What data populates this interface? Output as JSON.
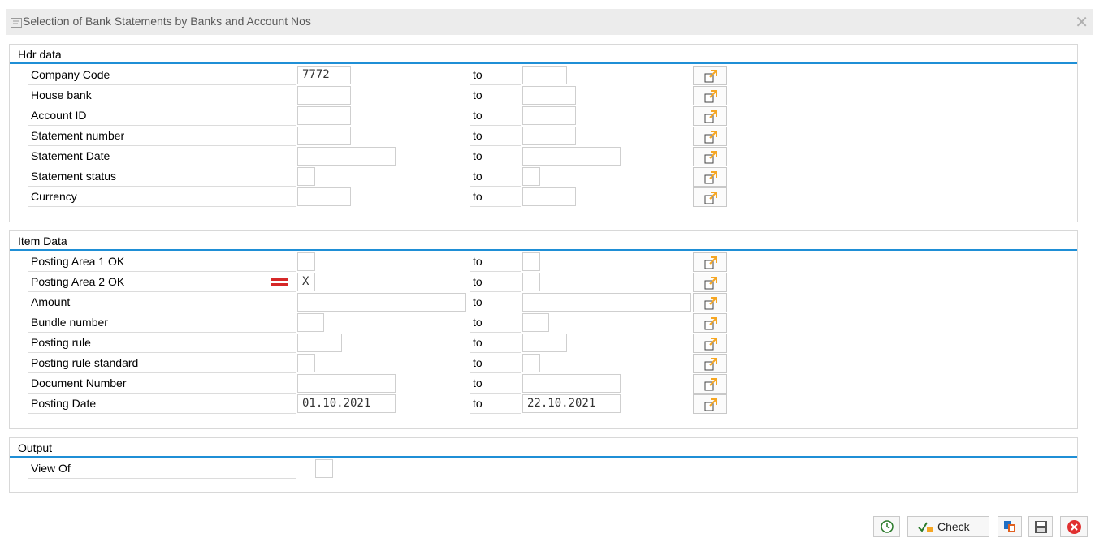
{
  "window": {
    "title": "Selection of Bank Statements by Banks and Account Nos"
  },
  "hdr": {
    "title": "Hdr data",
    "rows": [
      {
        "label": "Company Code",
        "from": "7772",
        "to_label": "to",
        "to": ""
      },
      {
        "label": "House bank",
        "from": "",
        "to_label": "to",
        "to": ""
      },
      {
        "label": "Account ID",
        "from": "",
        "to_label": "to",
        "to": ""
      },
      {
        "label": "Statement number",
        "from": "",
        "to_label": "to",
        "to": ""
      },
      {
        "label": "Statement Date",
        "from": "",
        "to_label": "to",
        "to": ""
      },
      {
        "label": "Statement status",
        "from": "",
        "to_label": "to",
        "to": ""
      },
      {
        "label": "Currency",
        "from": "",
        "to_label": "to",
        "to": ""
      }
    ]
  },
  "item": {
    "title": "Item Data",
    "rows": [
      {
        "label": "Posting Area 1 OK",
        "from": "",
        "to_label": "to",
        "to": ""
      },
      {
        "label": "Posting Area 2 OK",
        "from": "X",
        "to_label": "to",
        "to": ""
      },
      {
        "label": "Amount",
        "from": "",
        "to_label": "to",
        "to": ""
      },
      {
        "label": "Bundle number",
        "from": "",
        "to_label": "to",
        "to": ""
      },
      {
        "label": "Posting rule",
        "from": "",
        "to_label": "to",
        "to": ""
      },
      {
        "label": "Posting rule standard",
        "from": "",
        "to_label": "to",
        "to": ""
      },
      {
        "label": "Document Number",
        "from": "",
        "to_label": "to",
        "to": ""
      },
      {
        "label": "Posting Date",
        "from": "01.10.2021",
        "to_label": "to",
        "to": "22.10.2021"
      }
    ]
  },
  "output": {
    "title": "Output",
    "rows": [
      {
        "label": "View Of",
        "value": ""
      }
    ]
  },
  "toolbar": {
    "check_label": "Check"
  },
  "icons": {
    "title": "selection-screen-icon",
    "close": "close-icon",
    "multiple_selection": "multiple-selection-icon",
    "equal_option": "equal-option-icon",
    "execute": "clock-execute-icon",
    "check": "check-icon",
    "variants": "variants-icon",
    "save": "save-icon",
    "cancel": "cancel-icon"
  },
  "colors": {
    "accent_line": "#1f8fd6",
    "option_red": "#d62828",
    "arrow_orange": "#f5a623",
    "cancel_red": "#e03030"
  }
}
